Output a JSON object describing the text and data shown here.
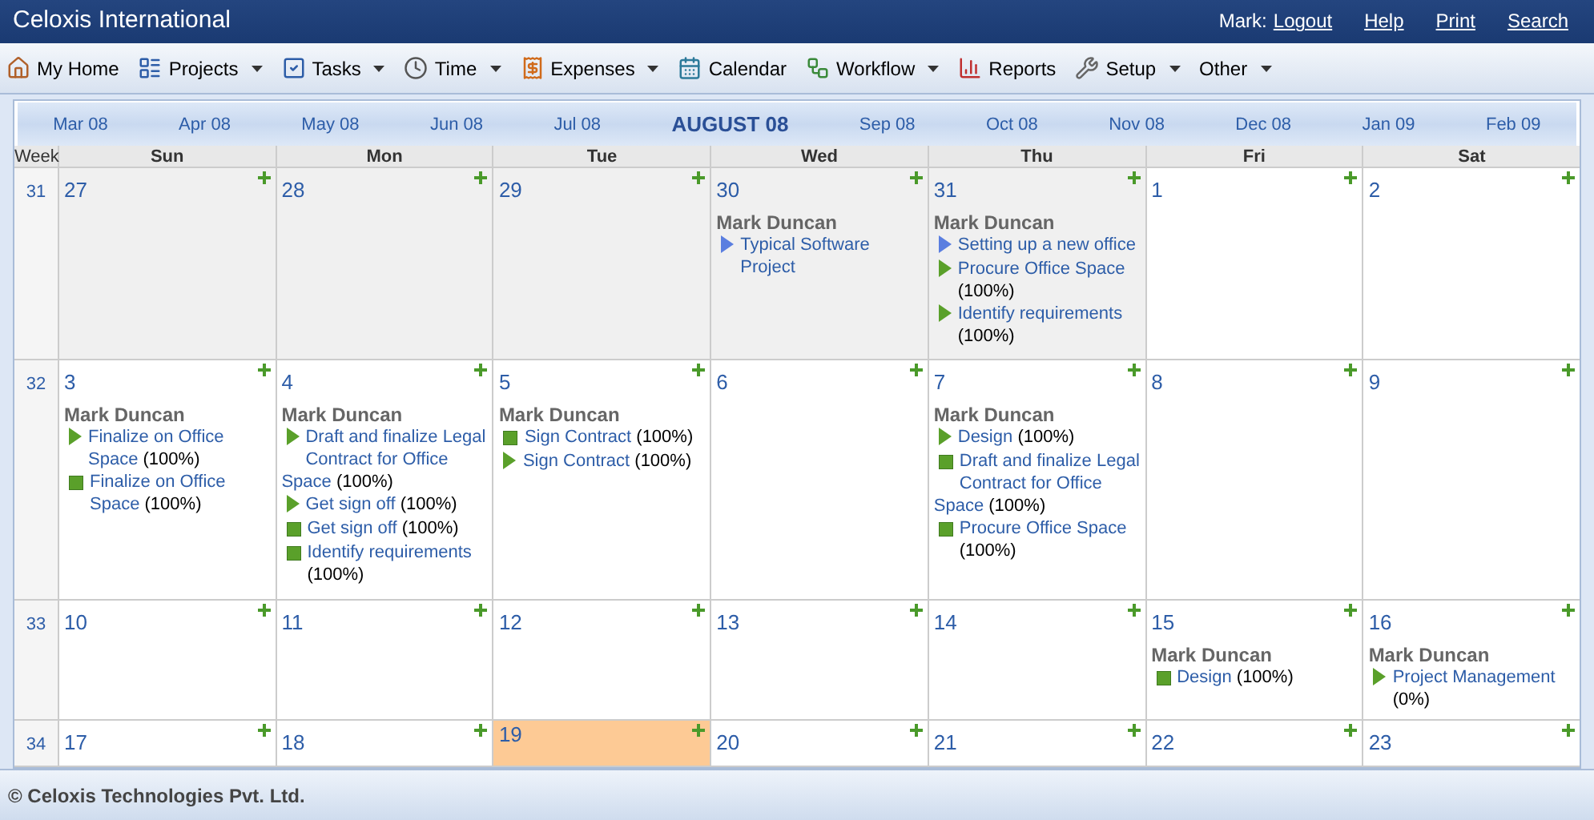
{
  "header": {
    "title": "Celoxis International",
    "user_label": "Mark:",
    "links": [
      "Logout",
      "Help",
      "Print",
      "Search"
    ]
  },
  "toolbar": [
    {
      "label": "My Home",
      "has_menu": false
    },
    {
      "label": "Projects",
      "has_menu": true
    },
    {
      "label": "Tasks",
      "has_menu": true
    },
    {
      "label": "Time",
      "has_menu": true
    },
    {
      "label": "Expenses",
      "has_menu": true
    },
    {
      "label": "Calendar",
      "has_menu": false
    },
    {
      "label": "Workflow",
      "has_menu": true
    },
    {
      "label": "Reports",
      "has_menu": false
    },
    {
      "label": "Setup",
      "has_menu": true
    },
    {
      "label": "Other",
      "has_menu": true
    }
  ],
  "months": [
    {
      "label": "Mar 08",
      "selected": false
    },
    {
      "label": "Apr 08",
      "selected": false
    },
    {
      "label": "May 08",
      "selected": false
    },
    {
      "label": "Jun 08",
      "selected": false
    },
    {
      "label": "Jul 08",
      "selected": false
    },
    {
      "label": "AUGUST 08",
      "selected": true
    },
    {
      "label": "Sep 08",
      "selected": false
    },
    {
      "label": "Oct 08",
      "selected": false
    },
    {
      "label": "Nov 08",
      "selected": false
    },
    {
      "label": "Dec 08",
      "selected": false
    },
    {
      "label": "Jan 09",
      "selected": false
    },
    {
      "label": "Feb 09",
      "selected": false
    }
  ],
  "week_label": "Week",
  "weekdays": [
    "Sun",
    "Mon",
    "Tue",
    "Wed",
    "Thu",
    "Fri",
    "Sat"
  ],
  "weeks": [
    {
      "number": "31",
      "days": [
        {
          "date": "27",
          "out_of_month": true,
          "today": false
        },
        {
          "date": "28",
          "out_of_month": true,
          "today": false
        },
        {
          "date": "29",
          "out_of_month": true,
          "today": false
        },
        {
          "date": "30",
          "out_of_month": true,
          "today": false,
          "person": "Mark Duncan",
          "events": [
            {
              "kind": "project",
              "title": "Typical Software Project"
            }
          ]
        },
        {
          "date": "31",
          "out_of_month": true,
          "today": false,
          "person": "Mark Duncan",
          "events": [
            {
              "kind": "project",
              "title": "Setting up a new office"
            },
            {
              "kind": "task",
              "title": "Procure Office Space",
              "progress": "(100%)"
            },
            {
              "kind": "task",
              "title": "Identify requirements",
              "progress": "(100%)"
            }
          ]
        },
        {
          "date": "1",
          "out_of_month": false,
          "today": false
        },
        {
          "date": "2",
          "out_of_month": false,
          "today": false
        }
      ]
    },
    {
      "number": "32",
      "days": [
        {
          "date": "3",
          "out_of_month": false,
          "today": false,
          "person": "Mark Duncan",
          "events": [
            {
              "kind": "task",
              "title": "Finalize on Office Space",
              "progress": "(100%)"
            },
            {
              "kind": "milestone",
              "title": "Finalize on Office Space",
              "progress": "(100%)"
            }
          ]
        },
        {
          "date": "4",
          "out_of_month": false,
          "today": false,
          "person": "Mark Duncan",
          "events": [
            {
              "kind": "task",
              "title": "Draft and finalize Legal Contract for Office Space",
              "progress": "(100%)"
            },
            {
              "kind": "task",
              "title": "Get sign off",
              "progress": "(100%)"
            },
            {
              "kind": "milestone",
              "title": "Get sign off",
              "progress": "(100%)"
            },
            {
              "kind": "milestone",
              "title": "Identify requirements",
              "progress": "(100%)"
            }
          ]
        },
        {
          "date": "5",
          "out_of_month": false,
          "today": false,
          "person": "Mark Duncan",
          "events": [
            {
              "kind": "milestone",
              "title": "Sign Contract",
              "progress": "(100%)"
            },
            {
              "kind": "task",
              "title": "Sign Contract",
              "progress": "(100%)"
            }
          ]
        },
        {
          "date": "6",
          "out_of_month": false,
          "today": false
        },
        {
          "date": "7",
          "out_of_month": false,
          "today": false,
          "person": "Mark Duncan",
          "events": [
            {
              "kind": "task",
              "title": "Design",
              "progress": "(100%)"
            },
            {
              "kind": "milestone",
              "title": "Draft and finalize Legal Contract for Office Space",
              "progress": "(100%)"
            },
            {
              "kind": "milestone",
              "title": "Procure Office Space",
              "progress": "(100%)"
            }
          ]
        },
        {
          "date": "8",
          "out_of_month": false,
          "today": false
        },
        {
          "date": "9",
          "out_of_month": false,
          "today": false
        }
      ]
    },
    {
      "number": "33",
      "days": [
        {
          "date": "10",
          "out_of_month": false,
          "today": false
        },
        {
          "date": "11",
          "out_of_month": false,
          "today": false
        },
        {
          "date": "12",
          "out_of_month": false,
          "today": false
        },
        {
          "date": "13",
          "out_of_month": false,
          "today": false
        },
        {
          "date": "14",
          "out_of_month": false,
          "today": false
        },
        {
          "date": "15",
          "out_of_month": false,
          "today": false,
          "person": "Mark Duncan",
          "events": [
            {
              "kind": "milestone",
              "title": "Design",
              "progress": "(100%)"
            }
          ]
        },
        {
          "date": "16",
          "out_of_month": false,
          "today": false,
          "person": "Mark Duncan",
          "events": [
            {
              "kind": "task",
              "title": "Project Management",
              "progress": "(0%)"
            }
          ]
        }
      ]
    },
    {
      "number": "34",
      "days": [
        {
          "date": "17",
          "out_of_month": false,
          "today": false
        },
        {
          "date": "18",
          "out_of_month": false,
          "today": false
        },
        {
          "date": "19",
          "out_of_month": false,
          "today": true
        },
        {
          "date": "20",
          "out_of_month": false,
          "today": false
        },
        {
          "date": "21",
          "out_of_month": false,
          "today": false
        },
        {
          "date": "22",
          "out_of_month": false,
          "today": false
        },
        {
          "date": "23",
          "out_of_month": false,
          "today": false
        }
      ]
    }
  ],
  "footer": "© Celoxis Technologies Pvt. Ltd."
}
